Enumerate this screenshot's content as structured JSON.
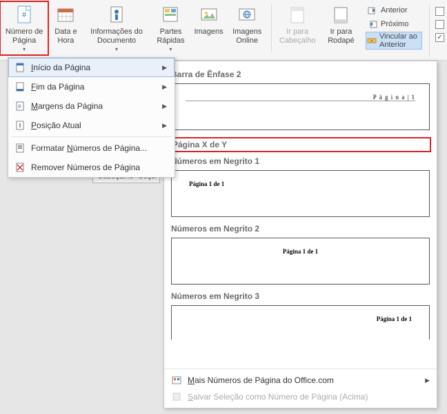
{
  "ribbon": {
    "numero_pagina": "Número de Página",
    "data_hora": "Data e Hora",
    "info_doc": "Informações do Documento",
    "partes_rapidas": "Partes Rápidas",
    "imagens": "Imagens",
    "imagens_online": "Imagens Online",
    "ir_cabecalho": "Ir para Cabeçalho",
    "ir_rodape": "Ir para Rodapé",
    "anterior": "Anterior",
    "proximo": "Próximo",
    "vincular": "Vincular ao Anterior"
  },
  "dropdown": {
    "inicio": "Início da Página",
    "fim": "Fim da Página",
    "margens": "Margens da Página",
    "posicao": "Posição Atual",
    "formatar": "Formatar Números de Página...",
    "remover": "Remover Números de Página"
  },
  "doc": {
    "header_tag": "Cabeçalho -Seçã"
  },
  "gallery": {
    "barra_enfase_2": "Barra de Ênfase 2",
    "barra_enfase_2_sample": "P á g i n a | 1",
    "pagina_x_de_y": "Página X de Y",
    "negrito_1": "Números em Negrito 1",
    "negrito_1_sample": "Página 1 de 1",
    "negrito_2": "Números em Negrito 2",
    "negrito_2_sample": "Página 1 de 1",
    "negrito_3": "Números em Negrito 3",
    "negrito_3_sample": "Página 1 de 1",
    "mais": "Mais Números de Página do Office.com",
    "salvar": "Salvar Seleção como Número de Página (Acima)"
  }
}
